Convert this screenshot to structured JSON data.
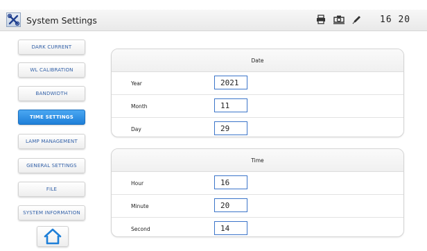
{
  "header": {
    "title": "System Settings",
    "clock": "16 20",
    "icons": [
      "printer-icon",
      "camera-icon",
      "pen-icon"
    ]
  },
  "sidebar": {
    "items": [
      {
        "label": "DARK CURRENT",
        "active": false
      },
      {
        "label": "WL CALIBRATION",
        "active": false
      },
      {
        "label": "BANDWIDTH",
        "active": false
      },
      {
        "label": "TIME SETTINGS",
        "active": true
      },
      {
        "label": "LAMP MANAGEMENT",
        "active": false
      },
      {
        "label": "GENERAL SETTINGS",
        "active": false
      },
      {
        "label": "FILE",
        "active": false
      },
      {
        "label": "SYSTEM INFORMATION",
        "active": false
      }
    ],
    "home_icon": "home-icon"
  },
  "date_panel": {
    "title": "Date",
    "rows": [
      {
        "label": "Year",
        "value": "2021"
      },
      {
        "label": "Month",
        "value": "11"
      },
      {
        "label": "Day",
        "value": "29"
      }
    ]
  },
  "time_panel": {
    "title": "Time",
    "rows": [
      {
        "label": "Hour",
        "value": "16"
      },
      {
        "label": "Minute",
        "value": "20"
      },
      {
        "label": "Second",
        "value": "14"
      }
    ]
  },
  "colors": {
    "accent": "#1e7fd8",
    "nav_text": "#2f5ea6",
    "input_border": "#3b74c9"
  }
}
